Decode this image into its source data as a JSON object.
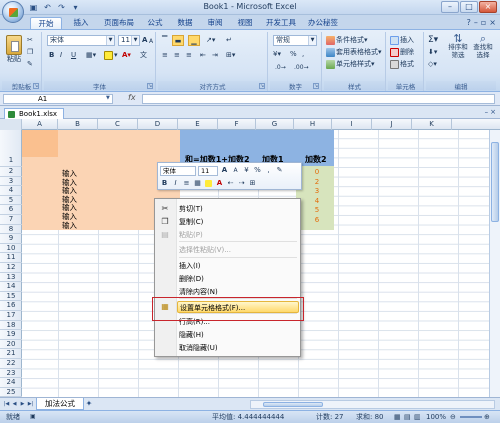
{
  "window": {
    "title": "Book1 - Microsoft Excel"
  },
  "qat": {
    "save_icon": "save-icon",
    "undo_icon": "undo-icon",
    "redo_icon": "redo-icon"
  },
  "tabs": [
    "开始",
    "插入",
    "页面布局",
    "公式",
    "数据",
    "审阅",
    "视图",
    "开发工具",
    "办公秘签"
  ],
  "ribbon": {
    "groups": {
      "clipboard": "剪贴板",
      "font": "字体",
      "align": "对齐方式",
      "number": "数字",
      "styles": "样式",
      "cells": "单元格",
      "editing": "编辑"
    },
    "paste_label": "粘贴",
    "font_name": "宋体",
    "font_size": "11",
    "number_format": "常规",
    "cond_format": "条件格式",
    "table_format": "套用表格格式",
    "cell_style": "单元格样式",
    "insert": "插入",
    "delete": "删除",
    "format": "格式",
    "sort_filter": "排序和\n筛选",
    "find_select": "查找和\n选择",
    "bold": "B",
    "italic": "I",
    "underline": "U",
    "grow": "A",
    "shrink": "A",
    "percent": "%",
    "comma": ","
  },
  "formula_bar": {
    "name_box": "A1",
    "fx": "fx",
    "value": ""
  },
  "doc_tab": {
    "name": "Book1.xlsx"
  },
  "columns": [
    "A",
    "B",
    "C",
    "D",
    "E",
    "F",
    "G",
    "H",
    "I",
    "J",
    "K"
  ],
  "rows": [
    "1",
    "2",
    "3",
    "4",
    "5",
    "6",
    "7",
    "8",
    "9",
    "10",
    "11",
    "12",
    "13",
    "14",
    "15",
    "16",
    "17",
    "18",
    "19",
    "20",
    "21",
    "22",
    "23",
    "24",
    "25"
  ],
  "sheet": {
    "header_text": "和=加数1+加数2",
    "header_f": "加数1",
    "header_g": "加数2",
    "input_label": "输入",
    "input_rows": [
      "输入",
      "输入",
      "输入",
      "输入",
      "输入",
      "输入",
      "输入"
    ],
    "g_values": [
      "0",
      "2",
      "3",
      "4",
      "5",
      "6"
    ]
  },
  "minitoolbar": {
    "font": "宋体",
    "size": "11",
    "percent": "%",
    "comma": ","
  },
  "context_menu": {
    "items": [
      {
        "label": "剪切(T)",
        "icon": "scissors-icon"
      },
      {
        "label": "复制(C)",
        "icon": "copy-icon"
      },
      {
        "label": "粘贴(P)",
        "icon": "paste-icon"
      },
      {
        "label": "选择性粘贴(V)...",
        "icon": ""
      },
      {
        "label": "插入(I)",
        "icon": ""
      },
      {
        "label": "删除(D)",
        "icon": ""
      },
      {
        "label": "清除内容(N)",
        "icon": ""
      },
      {
        "label": "设置单元格格式(F)...",
        "icon": "format-cells-icon"
      },
      {
        "label": "行高(R)...",
        "icon": ""
      },
      {
        "label": "隐藏(H)",
        "icon": ""
      },
      {
        "label": "取消隐藏(U)",
        "icon": ""
      }
    ]
  },
  "sheet_tabs": {
    "active": "加法公式"
  },
  "status": {
    "ready": "就绪",
    "average": "平均值: 4.444444444",
    "count": "计数: 27",
    "sum": "求和: 80",
    "zoom": "100%"
  },
  "colors": {
    "accent_blue": "#8db2e3",
    "header_fill": "#6fa0d8",
    "peach": "#f4c7a2",
    "green": "#d0ddb9",
    "highlight": "#ffd96b",
    "red_box": "#c8252c"
  }
}
